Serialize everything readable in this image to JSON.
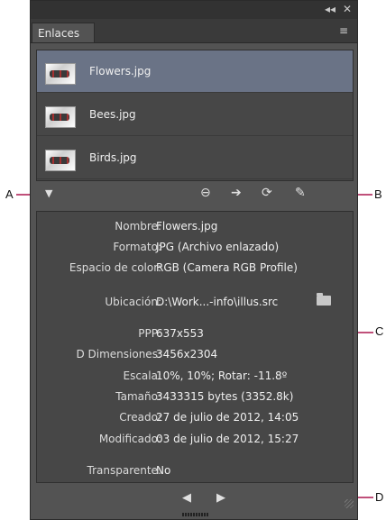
{
  "panel": {
    "topbar": {
      "collapse_glyph": "◂◂",
      "close_glyph": "✕"
    },
    "tab_label": "Enlaces",
    "menu_icon": "≡"
  },
  "links": [
    {
      "name": "Flowers.jpg",
      "selected": true
    },
    {
      "name": "Bees.jpg",
      "selected": false
    },
    {
      "name": "Birds.jpg",
      "selected": false
    }
  ],
  "toolbar": {
    "toggle_glyph": "▼",
    "relink_glyph": "⊖",
    "goto_glyph": "➔",
    "update_glyph": "⟳",
    "edit_glyph": "✎"
  },
  "info": {
    "rows": [
      {
        "label": "Nombre:",
        "value": "Flowers.jpg"
      },
      {
        "label": "Formato:",
        "value": "JPG (Archivo enlazado)"
      },
      {
        "label": "Espacio de color:",
        "value": "RGB (Camera RGB Profile)"
      },
      {
        "label": "Ubicación:",
        "value": "D:\\Work...-info\\illus.src"
      },
      {
        "label": "PPP:",
        "value": "637x553"
      },
      {
        "label": "D Dimensiones:",
        "value": "3456x2304"
      },
      {
        "label": "Escala:",
        "value": "10%, 10%; Rotar: -11.8º"
      },
      {
        "label": "Tamaño:",
        "value": "3433315 bytes (3352.8k)"
      },
      {
        "label": "Creado:",
        "value": "27 de julio de 2012, 14:05"
      },
      {
        "label": "Modificado:",
        "value": "03 de julio de 2012, 15:27"
      },
      {
        "label": "Transparente:",
        "value": "No"
      }
    ]
  },
  "footer": {
    "prev_glyph": "◀",
    "next_glyph": "▶"
  },
  "callouts": {
    "a": "A",
    "b": "B",
    "c": "C",
    "d": "D"
  },
  "colors": {
    "panel_bg": "#535353",
    "selected_row": "#6a7386",
    "callout_line": "#c0507a"
  }
}
